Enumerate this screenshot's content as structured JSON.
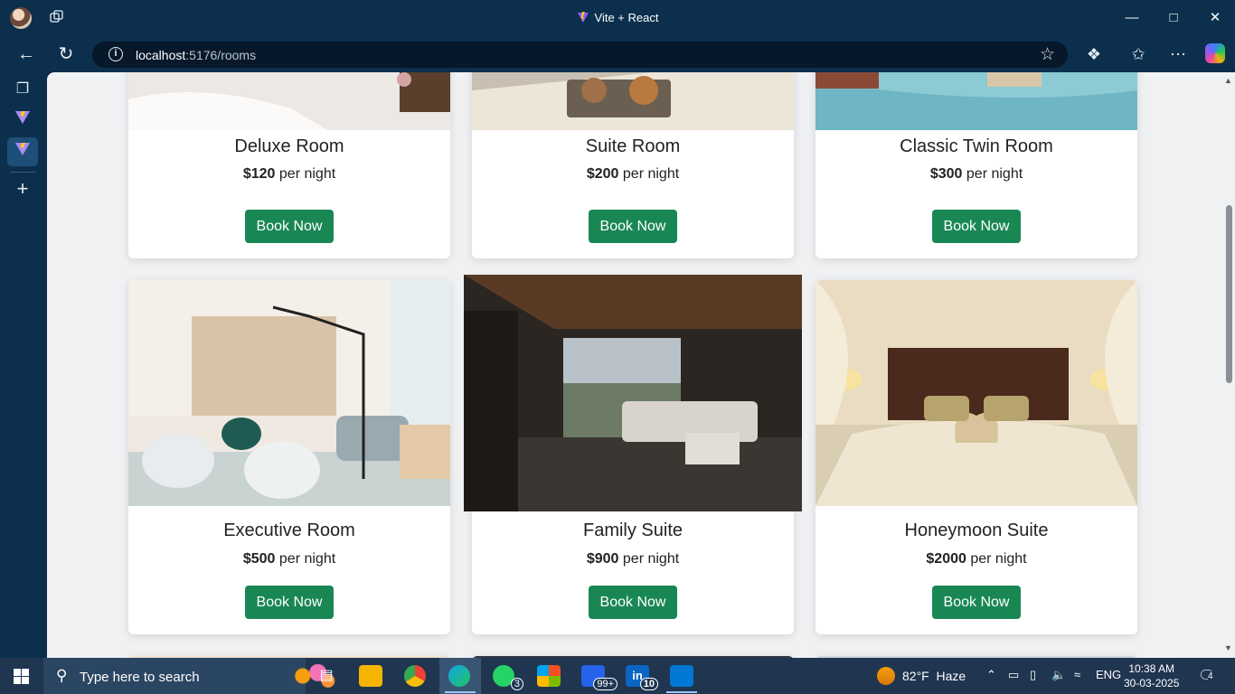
{
  "browser": {
    "tab_title": "Vite + React",
    "url_host": "localhost",
    "url_path": ":5176/rooms"
  },
  "rooms": [
    {
      "name": "Deluxe Room",
      "price": "$120",
      "per": "per night",
      "button": "Book Now"
    },
    {
      "name": "Suite Room",
      "price": "$200",
      "per": "per night",
      "button": "Book Now"
    },
    {
      "name": "Classic Twin Room",
      "price": "$300",
      "per": "per night",
      "button": "Book Now"
    },
    {
      "name": "Executive Room",
      "price": "$500",
      "per": "per night",
      "button": "Book Now"
    },
    {
      "name": "Family Suite",
      "price": "$900",
      "per": "per night",
      "button": "Book Now"
    },
    {
      "name": "Honeymoon Suite",
      "price": "$2000",
      "per": "per night",
      "button": "Book Now"
    }
  ],
  "taskbar": {
    "search_placeholder": "Type here to search",
    "whatsapp_badge": "3",
    "mail_badge": "99+",
    "linkedin_badge": "10",
    "weather_temp": "82°F",
    "weather_text": "Haze",
    "language": "ENG",
    "time": "10:38 AM",
    "date": "30-03-2025",
    "notifications": "4"
  },
  "colors": {
    "accent_button": "#198754",
    "chrome_bg": "#0b2f4d",
    "taskbar_bg": "#1f3550"
  }
}
